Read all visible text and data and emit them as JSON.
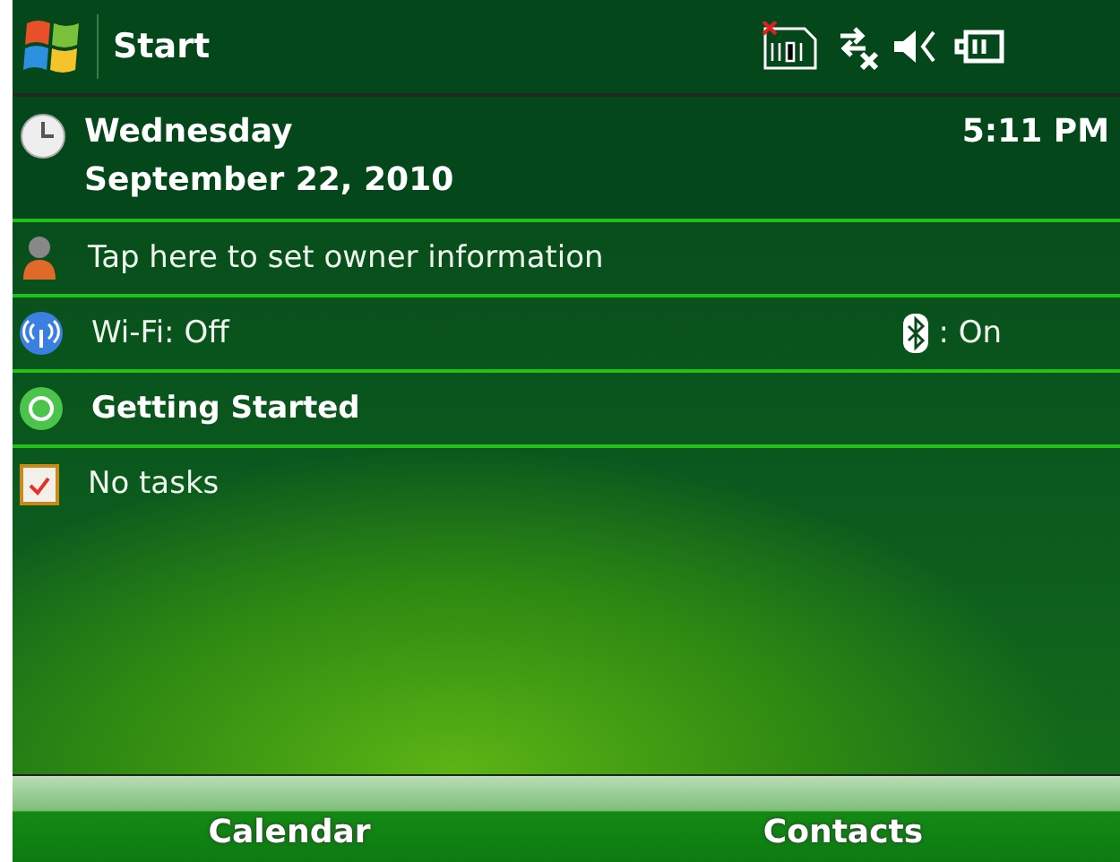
{
  "title_bar": {
    "title": "Start"
  },
  "date_row": {
    "day": "Wednesday",
    "date": "September 22, 2010",
    "time": "5:11 PM"
  },
  "items": [
    {
      "kind": "owner",
      "label": "Tap here to set owner information"
    },
    {
      "kind": "wifi",
      "label": "Wi-Fi: Off",
      "bluetooth": ": On"
    },
    {
      "kind": "getting_started",
      "label": "Getting Started"
    },
    {
      "kind": "tasks",
      "label": "No tasks"
    }
  ],
  "soft_keys": [
    "Calendar",
    "Contacts"
  ]
}
